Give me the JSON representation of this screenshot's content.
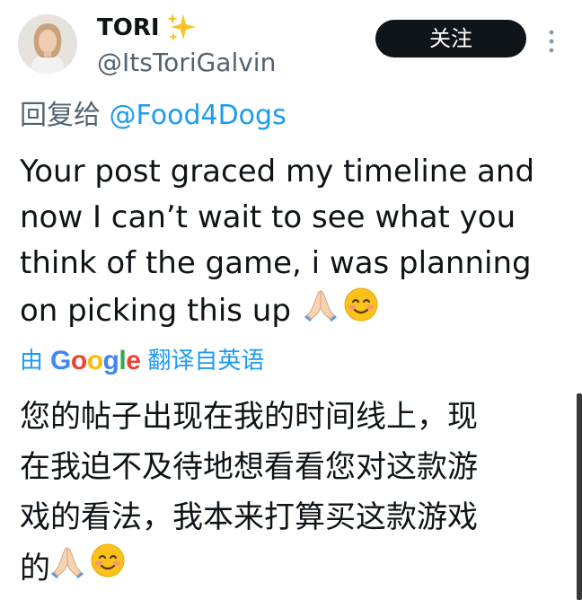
{
  "author": {
    "display_name": "TORI",
    "handle": "@ItsToriGalvin",
    "name_badge_icon": "sparkles-icon"
  },
  "actions": {
    "follow_label": "关注",
    "more_icon": "more-vertical-icon"
  },
  "reply": {
    "prefix": "回复给",
    "mention": "@Food4Dogs"
  },
  "tweet": {
    "lines": [
      "Your post graced my timeline and",
      "now I can’t wait to see what you",
      "think of the game, i was planning",
      "on picking this up"
    ],
    "trailing_emoji": [
      "folded-hands-emoji",
      "smiling-face-emoji"
    ]
  },
  "translation": {
    "by_label": "由",
    "engine": "Google",
    "source_label": "翻译自英语",
    "lines": [
      "您的帖子出现在我的时间线上，现",
      "在我迫不及待地想看看您对这款游",
      "戏的看法，我本来打算买这款游戏",
      "的"
    ]
  },
  "colors": {
    "link_blue": "#1d9bf0",
    "secondary_text": "#536471",
    "primary_text": "#0f1419",
    "follow_button_bg": "#0f1419"
  }
}
